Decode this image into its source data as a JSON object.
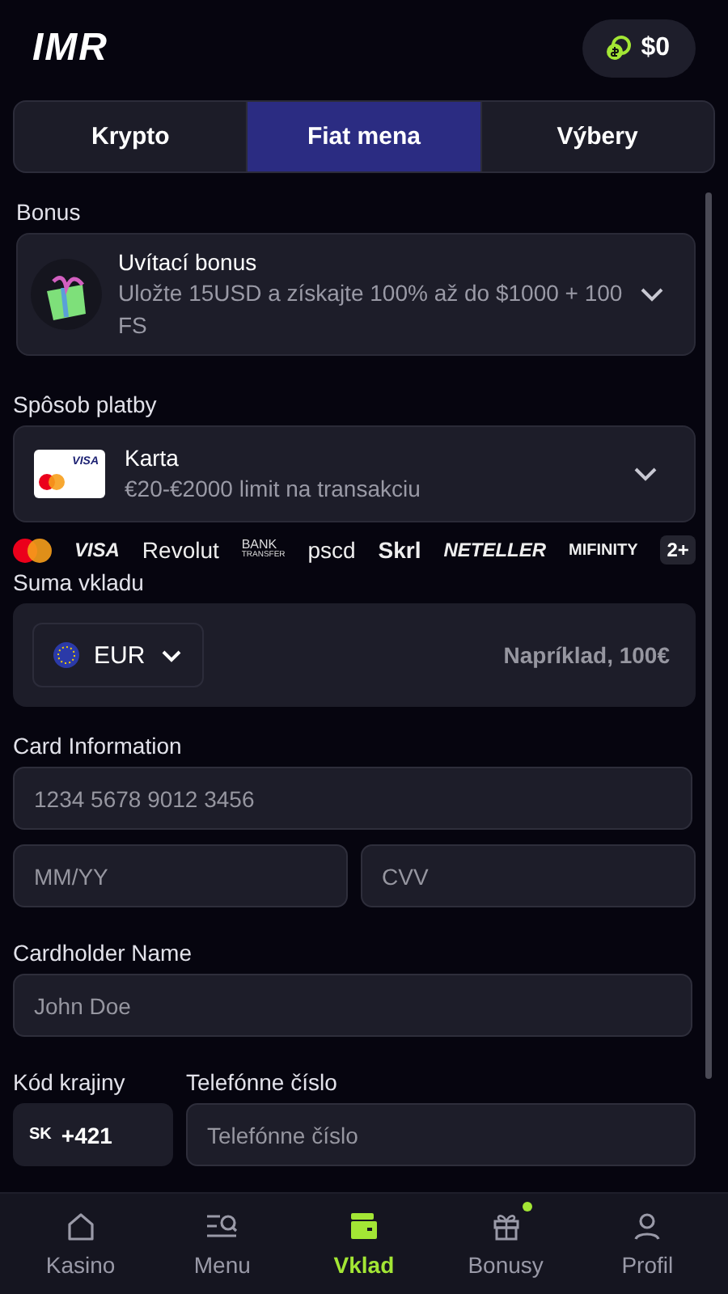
{
  "header": {
    "logo": "IMR",
    "balance": "$0"
  },
  "tabs": [
    {
      "label": "Krypto",
      "selected": false
    },
    {
      "label": "Fiat mena",
      "selected": true
    },
    {
      "label": "Výbery",
      "selected": false
    }
  ],
  "bonus": {
    "label": "Bonus",
    "title": "Uvítací bonus",
    "description": "Uložte 15USD a získajte 100% až do $1000 + 100 FS"
  },
  "payment": {
    "label": "Spôsob platby",
    "title": "Karta",
    "description": "€20-€2000 limit na transakciu",
    "card_brand": "VISA"
  },
  "payment_logos": [
    {
      "kind": "mastercard"
    },
    {
      "kind": "italic",
      "text": "VISA"
    },
    {
      "kind": "plain",
      "text": "Revolut"
    },
    {
      "kind": "bank",
      "text": "BANK",
      "subtext": "TRANSFER"
    },
    {
      "kind": "plain",
      "text": "pscd"
    },
    {
      "kind": "bold",
      "text": "Skrl"
    },
    {
      "kind": "italic",
      "text": "NETELLER"
    },
    {
      "kind": "mifinity",
      "text": "MIFINITY"
    },
    {
      "kind": "more",
      "text": "2+"
    }
  ],
  "amount": {
    "label": "Suma vkladu",
    "currency": "EUR",
    "placeholder": "Napríklad, 100€"
  },
  "card_info": {
    "label": "Card Information",
    "number_placeholder": "1234 5678 9012 3456",
    "expiry_placeholder": "MM/YY",
    "cvv_placeholder": "CVV"
  },
  "cardholder": {
    "label": "Cardholder Name",
    "placeholder": "John Doe"
  },
  "phone": {
    "country_label": "Kód krajiny",
    "country_code": "SK",
    "dial_code": "+421",
    "number_label": "Telefónne číslo",
    "number_placeholder": "Telefónne číslo"
  },
  "nav": [
    {
      "label": "Kasino",
      "selected": false,
      "badge": false
    },
    {
      "label": "Menu",
      "selected": false,
      "badge": false
    },
    {
      "label": "Vklad",
      "selected": true,
      "badge": false
    },
    {
      "label": "Bonusy",
      "selected": false,
      "badge": true
    },
    {
      "label": "Profil",
      "selected": false,
      "badge": false
    }
  ]
}
